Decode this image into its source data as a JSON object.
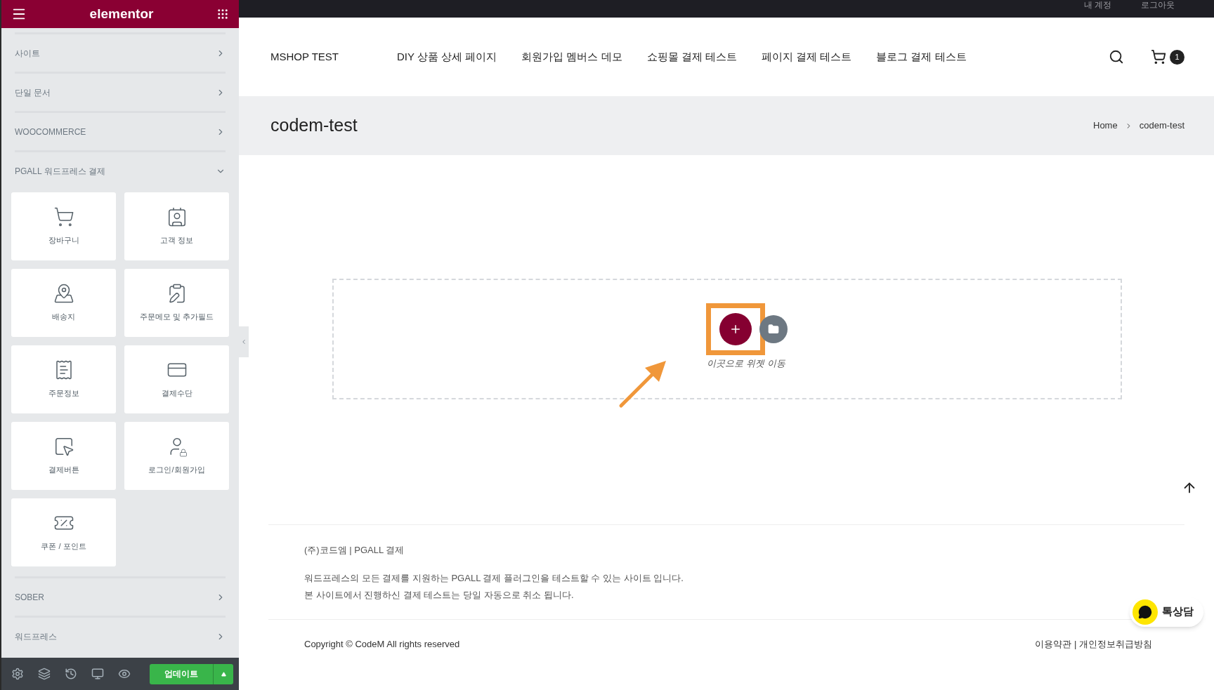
{
  "editor": {
    "logo": "elementor",
    "categories_top": [
      {
        "label": "사이트",
        "expanded": false
      },
      {
        "label": "단일 문서",
        "expanded": false
      },
      {
        "label": "WOOCOMMERCE",
        "expanded": false
      },
      {
        "label": "PGALL 워드프레스 결제",
        "expanded": true
      }
    ],
    "widgets": [
      "장바구니",
      "고객 정보",
      "배송지",
      "주문메모 및 추가필드",
      "주문정보",
      "결제수단",
      "결제버튼",
      "로그인/회원가입",
      "쿠폰 / 포인트"
    ],
    "categories_bottom": [
      {
        "label": "SOBER",
        "expanded": false
      },
      {
        "label": "워드프레스",
        "expanded": false
      }
    ],
    "update_button": "업데이트"
  },
  "site": {
    "top_links": [
      "내 계정",
      "로그아웃"
    ],
    "brand": "MSHOP TEST",
    "nav": [
      "DIY 상품 상세 페이지",
      "회원가입 멤버스 데모",
      "쇼핑몰 결제 테스트",
      "페이지 결제 테스트",
      "블로그 결제 테스트"
    ],
    "cart_count": "1",
    "page_title": "codem-test",
    "breadcrumb": [
      "Home",
      "codem-test"
    ],
    "drop_hint": "이곳으로 위젯 이동",
    "footer": {
      "company": "(주)코드엠 | PGALL 결제",
      "lines": [
        "워드프레스의 모든 결제를 지원하는 PGALL 결제 플러그인을 테스트할 수 있는 사이트 입니다.",
        "본 사이트에서 진행하신 결제 테스트는 당일 자동으로 취소 됩니다."
      ],
      "copyright": "Copyright © CodeM All rights reserved",
      "links": "이용약관 | 개인정보취급방침"
    },
    "chat_button": "톡상담"
  }
}
